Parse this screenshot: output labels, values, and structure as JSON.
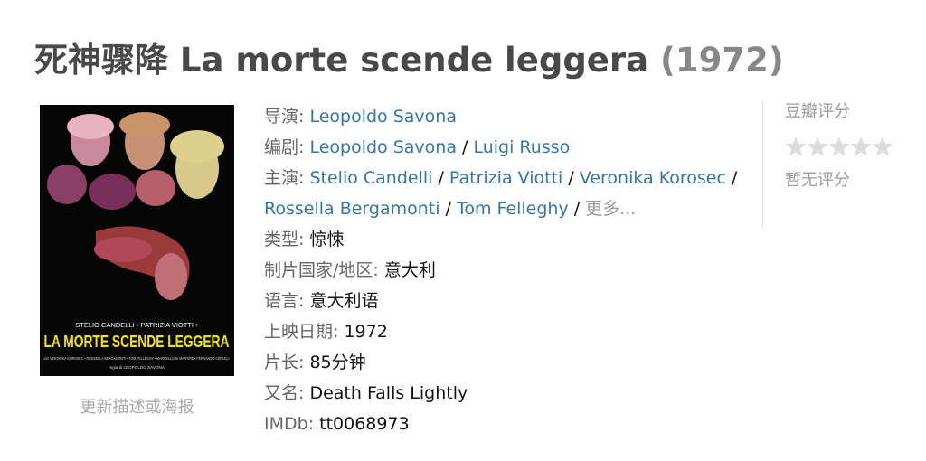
{
  "title": {
    "cn": "死神骤降",
    "original": "La morte scende leggera",
    "year": "(1972)"
  },
  "poster": {
    "cast_line": "STELIO CANDELLI • PATRIZIA VIOTTI •",
    "film_title": "LA MORTE SCENDE LEGGERA",
    "supporting_cast": "con VERONIKA KOROSEC • ROSSELLA BERGAMONTI • TOM FELLEGHY • MARCELLO DI MARTIRE • FERNANDO CERULLI",
    "director_line": "regia di LEOPOLDO SAVONA",
    "caption": "更新描述或海报"
  },
  "info": {
    "director": {
      "label": "导演",
      "names": [
        "Leopoldo Savona"
      ]
    },
    "writer": {
      "label": "编剧",
      "names": [
        "Leopoldo Savona",
        "Luigi Russo"
      ]
    },
    "cast": {
      "label": "主演",
      "names": [
        "Stelio Candelli",
        "Patrizia Viotti",
        "Veronika Korosec",
        "Rossella Bergamonti",
        "Tom Felleghy"
      ],
      "more": "更多..."
    },
    "genre": {
      "label": "类型",
      "value": "惊悚"
    },
    "country": {
      "label": "制片国家/地区",
      "value": "意大利"
    },
    "language": {
      "label": "语言",
      "value": "意大利语"
    },
    "release": {
      "label": "上映日期",
      "value": "1972"
    },
    "runtime": {
      "label": "片长",
      "value": "85分钟"
    },
    "aka": {
      "label": "又名",
      "value": "Death Falls Lightly"
    },
    "imdb": {
      "label": "IMDb",
      "value": "tt0068973"
    }
  },
  "rating": {
    "title": "豆瓣评分",
    "stars_filled": 0,
    "stars_total": 5,
    "empty_text": "暂无评分",
    "star_color": "#dddddd"
  },
  "colors": {
    "link": "#3377aa",
    "label": "#666666",
    "title": "#494949",
    "year": "#888888",
    "poster_title": "#f2e600"
  }
}
